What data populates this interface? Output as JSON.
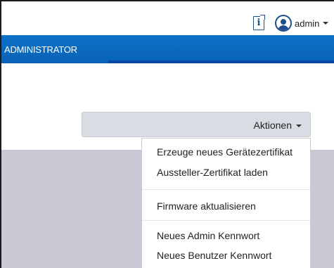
{
  "header": {
    "info_icon": "info-icon",
    "user_icon": "user-avatar-icon",
    "user_name": "admin"
  },
  "nav": {
    "active_tab": "ADMINISTRATOR"
  },
  "actions": {
    "label": "Aktionen",
    "menu": [
      "Erzeuge neues Gerätezertifikat",
      "Aussteller-Zertifikat laden",
      "Firmware aktualisieren",
      "Neues Admin Kennwort",
      "Neues Benutzer Kennwort"
    ]
  },
  "colors": {
    "navbar": "#0c71c7",
    "nav_underline": "#0646a3",
    "icon_blue": "#1f4e8c",
    "button_bg": "#d9dde3",
    "backdrop": "#c8c9d4"
  }
}
